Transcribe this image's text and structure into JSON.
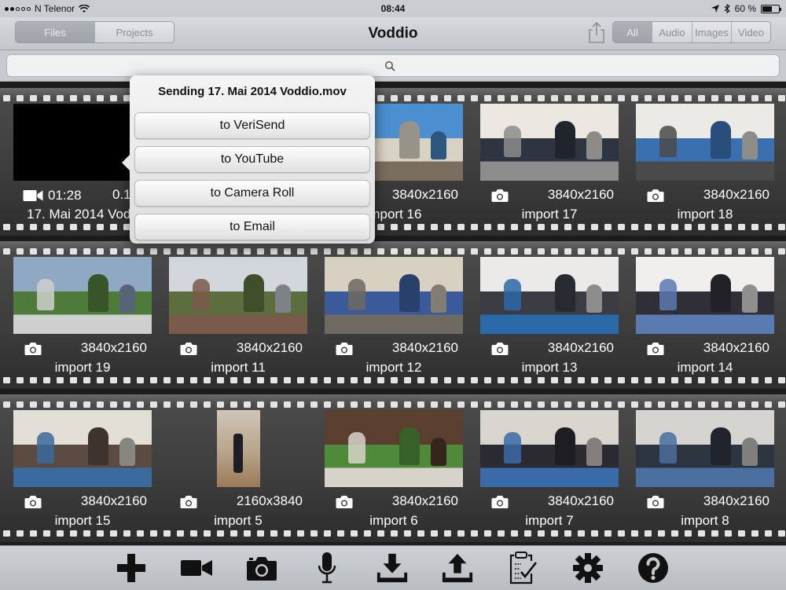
{
  "status_bar": {
    "carrier": "N Telenor",
    "time": "08:44",
    "battery": "60 %",
    "battery_level": 0.6
  },
  "nav": {
    "title": "Voddio",
    "left_tabs": [
      {
        "label": "Files",
        "active": true
      },
      {
        "label": "Projects",
        "active": false
      }
    ],
    "right_tabs": [
      {
        "label": "All",
        "active": true
      },
      {
        "label": "Audio",
        "active": false
      },
      {
        "label": "Images",
        "active": false
      },
      {
        "label": "Video",
        "active": false
      }
    ],
    "share_icon": "share-icon"
  },
  "search": {
    "placeholder": "",
    "icon": "search-icon"
  },
  "rows": [
    [
      {
        "type": "video",
        "duration": "01:28",
        "resolution": "0.1",
        "name": "17. Mai 2014 Vodd"
      },
      {
        "type": "image",
        "resolution": "3840x2160",
        "name": "import 16"
      },
      {
        "type": "image",
        "resolution": "3840x2160",
        "name": "import 16"
      },
      {
        "type": "image",
        "resolution": "3840x2160",
        "name": "import 17"
      },
      {
        "type": "image",
        "resolution": "3840x2160",
        "name": "import 18"
      }
    ],
    [
      {
        "type": "image",
        "resolution": "3840x2160",
        "name": "import 19"
      },
      {
        "type": "image",
        "resolution": "3840x2160",
        "name": "import 11"
      },
      {
        "type": "image",
        "resolution": "3840x2160",
        "name": "import 12"
      },
      {
        "type": "image",
        "resolution": "3840x2160",
        "name": "import 13"
      },
      {
        "type": "image",
        "resolution": "3840x2160",
        "name": "import 14"
      }
    ],
    [
      {
        "type": "image",
        "resolution": "3840x2160",
        "name": "import 15"
      },
      {
        "type": "image",
        "resolution": "2160x3840",
        "name": "import 5"
      },
      {
        "type": "image",
        "resolution": "3840x2160",
        "name": "import 6"
      },
      {
        "type": "image",
        "resolution": "3840x2160",
        "name": "import 7"
      },
      {
        "type": "image",
        "resolution": "3840x2160",
        "name": "import 8"
      }
    ]
  ],
  "popover": {
    "title": "Sending 17. Mai 2014 Voddio.mov",
    "options": [
      "to VeriSend",
      "to YouTube",
      "to Camera Roll",
      "to Email"
    ]
  },
  "toolbar": {
    "icons": [
      "add-icon",
      "video-camera-icon",
      "camera-icon",
      "microphone-icon",
      "download-icon",
      "upload-icon",
      "clipboard-check-icon",
      "gear-icon",
      "help-icon"
    ]
  }
}
